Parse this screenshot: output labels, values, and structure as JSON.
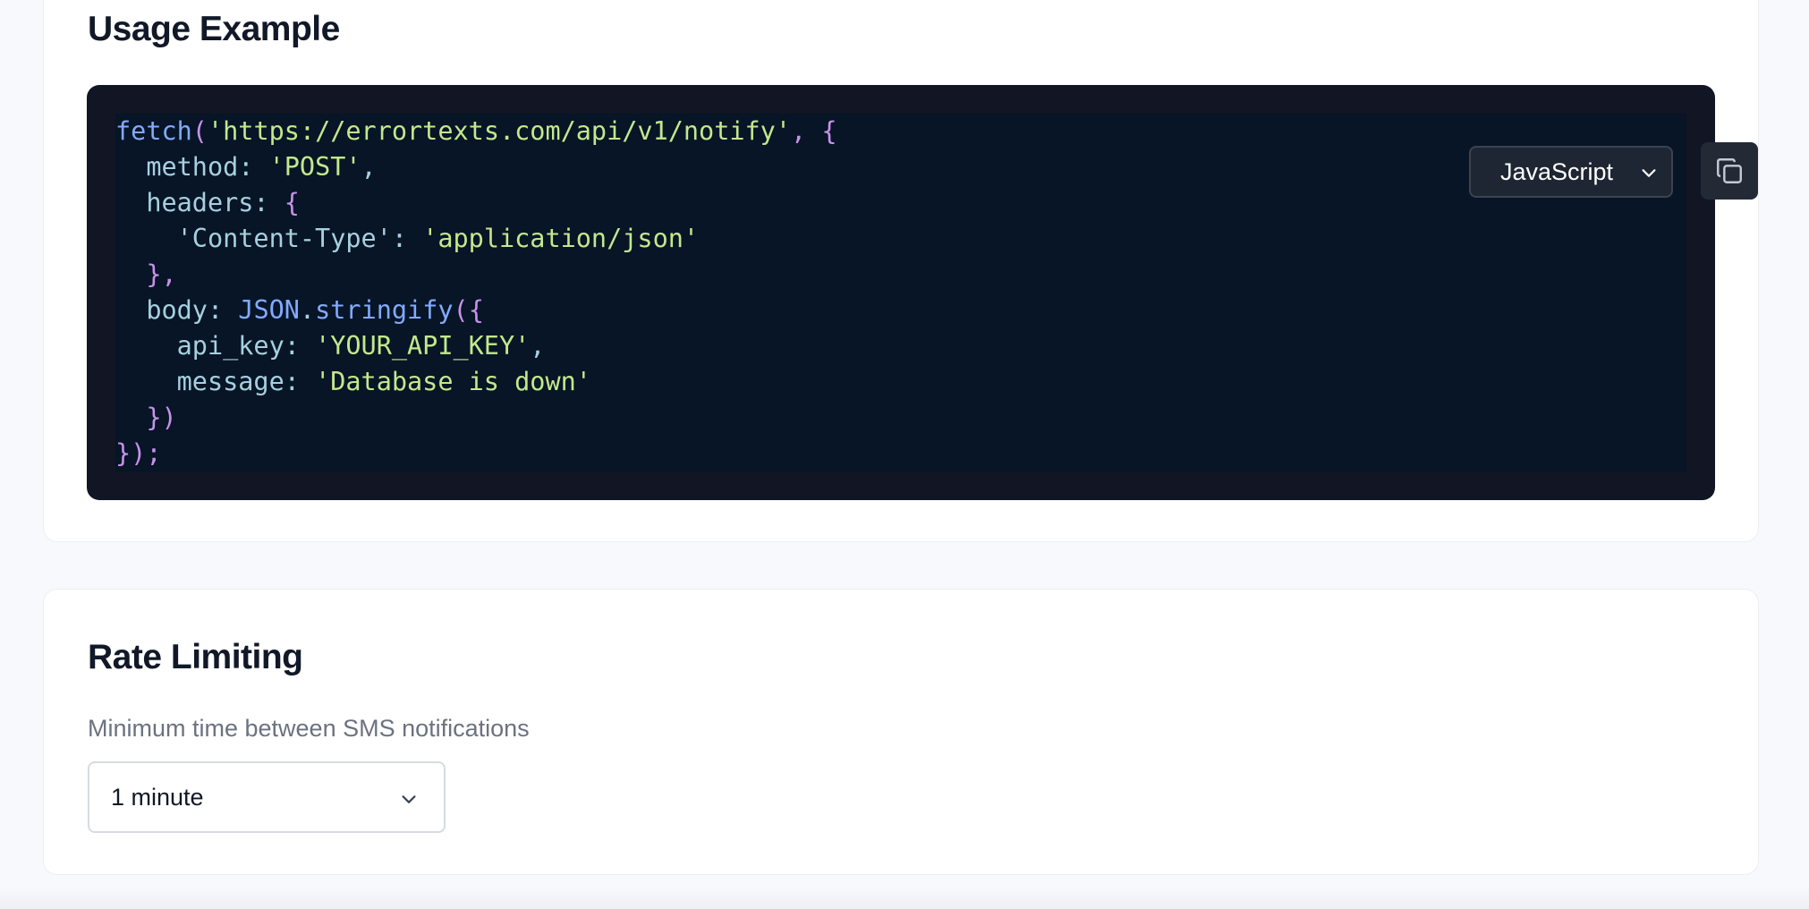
{
  "usage": {
    "title": "Usage Example",
    "language_selected": "JavaScript",
    "copy_icon": "copy-icon",
    "code": {
      "l1_fn": "fetch",
      "l1_open": "(",
      "l1_url": "'https://errortexts.com/api/v1/notify'",
      "l1_rest": ", {",
      "l2_key": "  method: ",
      "l2_val": "'POST'",
      "l2_end": ",",
      "l3_key": "  headers: ",
      "l3_brace": "{",
      "l4_key": "    'Content-Type'",
      "l4_colon": ": ",
      "l4_val": "'application/json'",
      "l5": "  },",
      "l6_key": "  body: ",
      "l6_fn": "JSON",
      "l6_dot": ".",
      "l6_method": "stringify",
      "l6_open": "({",
      "l7_key": "    api_key: ",
      "l7_val": "'YOUR_API_KEY'",
      "l7_end": ",",
      "l8_key": "    message: ",
      "l8_val": "'Database is down'",
      "l9": "  })",
      "l10": "});"
    }
  },
  "rate": {
    "title": "Rate Limiting",
    "label": "Minimum time between SMS notifications",
    "selected": "1 minute"
  },
  "colors": {
    "code_bg": "#071526",
    "frame_bg": "#111524",
    "string": "#c3e88d",
    "function": "#82aaff",
    "punctuation": "#c792ea",
    "key": "#a6d0e0"
  }
}
